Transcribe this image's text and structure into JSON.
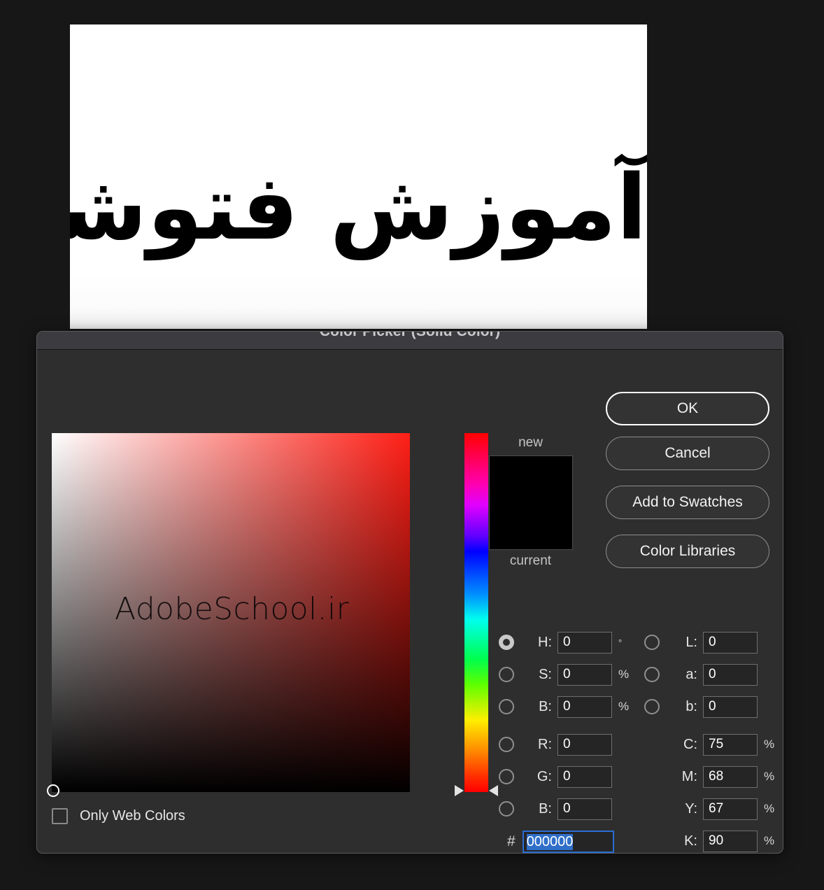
{
  "background": {
    "app_background_color": "#171717",
    "canvas": {
      "text": "آموزش فتوشاپ",
      "text_color": "#000000",
      "background_color": "#ffffff"
    }
  },
  "dialog": {
    "title": "Color Picker (Solid Color)",
    "titlebar_color": "#3b3b40",
    "body_color": "#2e2e2e",
    "watermark": "AdobeSchool.ir",
    "sv_field": {
      "hue_color": "#ff1f16",
      "marker_position": "bottom-left"
    },
    "hue_slider": {
      "value": 0,
      "marker_position": "bottom"
    },
    "only_web_colors": {
      "label": "Only Web Colors",
      "checked": false
    },
    "preview": {
      "new_label": "new",
      "current_label": "current",
      "new_color": "#000000",
      "current_color": "#000000"
    },
    "buttons": [
      {
        "label": "OK",
        "primary": true
      },
      {
        "label": "Cancel",
        "primary": false
      },
      {
        "label": "Add to Swatches",
        "primary": false
      },
      {
        "label": "Color Libraries",
        "primary": false
      }
    ],
    "hsb": {
      "selected": "H",
      "h": {
        "label": "H:",
        "value": "0",
        "unit": "°"
      },
      "s": {
        "label": "S:",
        "value": "0",
        "unit": "%"
      },
      "b": {
        "label": "B:",
        "value": "0",
        "unit": "%"
      }
    },
    "lab": {
      "l": {
        "label": "L:",
        "value": "0"
      },
      "a": {
        "label": "a:",
        "value": "0"
      },
      "b": {
        "label": "b:",
        "value": "0"
      }
    },
    "rgb": {
      "r": {
        "label": "R:",
        "value": "0"
      },
      "g": {
        "label": "G:",
        "value": "0"
      },
      "b": {
        "label": "B:",
        "value": "0"
      }
    },
    "cmyk": {
      "c": {
        "label": "C:",
        "value": "75",
        "unit": "%"
      },
      "m": {
        "label": "M:",
        "value": "68",
        "unit": "%"
      },
      "y": {
        "label": "Y:",
        "value": "67",
        "unit": "%"
      },
      "k": {
        "label": "K:",
        "value": "90",
        "unit": "%"
      }
    },
    "hex": {
      "prefix": "#",
      "value": "000000",
      "selected": true,
      "focus_color": "#2b6cd4"
    }
  }
}
